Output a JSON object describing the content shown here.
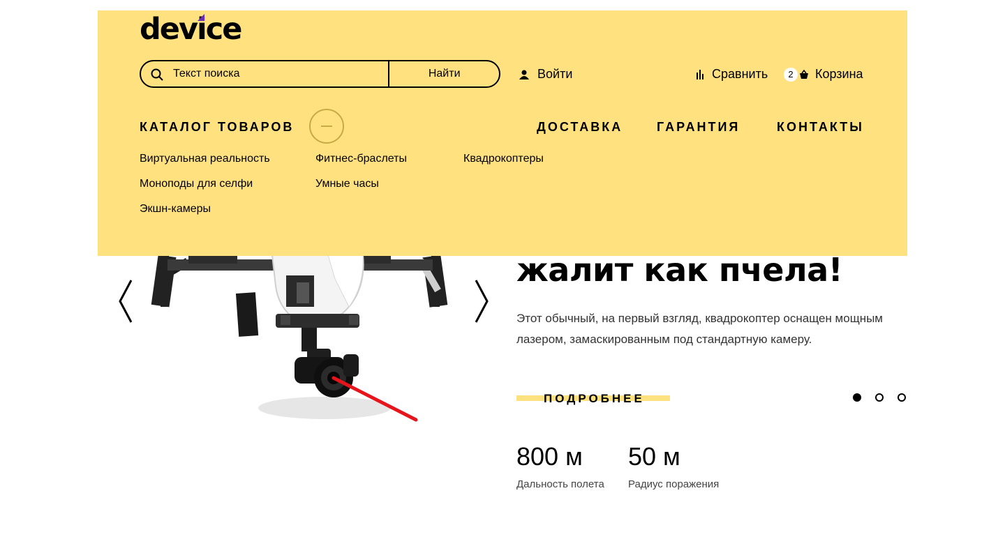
{
  "header": {
    "logo": "device",
    "search": {
      "placeholder": "Текст поиска",
      "button_label": "Найти"
    },
    "login_label": "Войти",
    "compare_label": "Сравнить",
    "cart": {
      "count": "2",
      "label": "Корзина"
    },
    "colors": {
      "panel": "#ffe180",
      "logo_accent": "#6a2fb0",
      "toggle_border": "#c9a943"
    }
  },
  "nav": {
    "catalog_label": "КАТАЛОГ ТОВАРОВ",
    "delivery_label": "ДОСТАВКА",
    "warranty_label": "ГАРАНТИЯ",
    "contacts_label": "КОНТАКТЫ"
  },
  "catalog": {
    "categories": [
      "Виртуальная реальность",
      "Фитнес-браслеты",
      "Квадрокоптеры",
      "Моноподы для селфи",
      "Умные часы",
      "Экшн-камеры"
    ]
  },
  "slide": {
    "title": "жалит как пчела!",
    "description": "Этот обычный, на первый взгляд, квадрокоптер оснащен мощным лазером, замаскированным под стандартную камеру.",
    "more_label": "ПОДРОБНЕЕ",
    "stats": [
      {
        "value": "800 м",
        "caption": "Дальность полета"
      },
      {
        "value": "50 м",
        "caption": "Радиус поражения"
      }
    ],
    "active_slide": 1,
    "slide_count": 3,
    "laser_color": "#e8141b"
  }
}
